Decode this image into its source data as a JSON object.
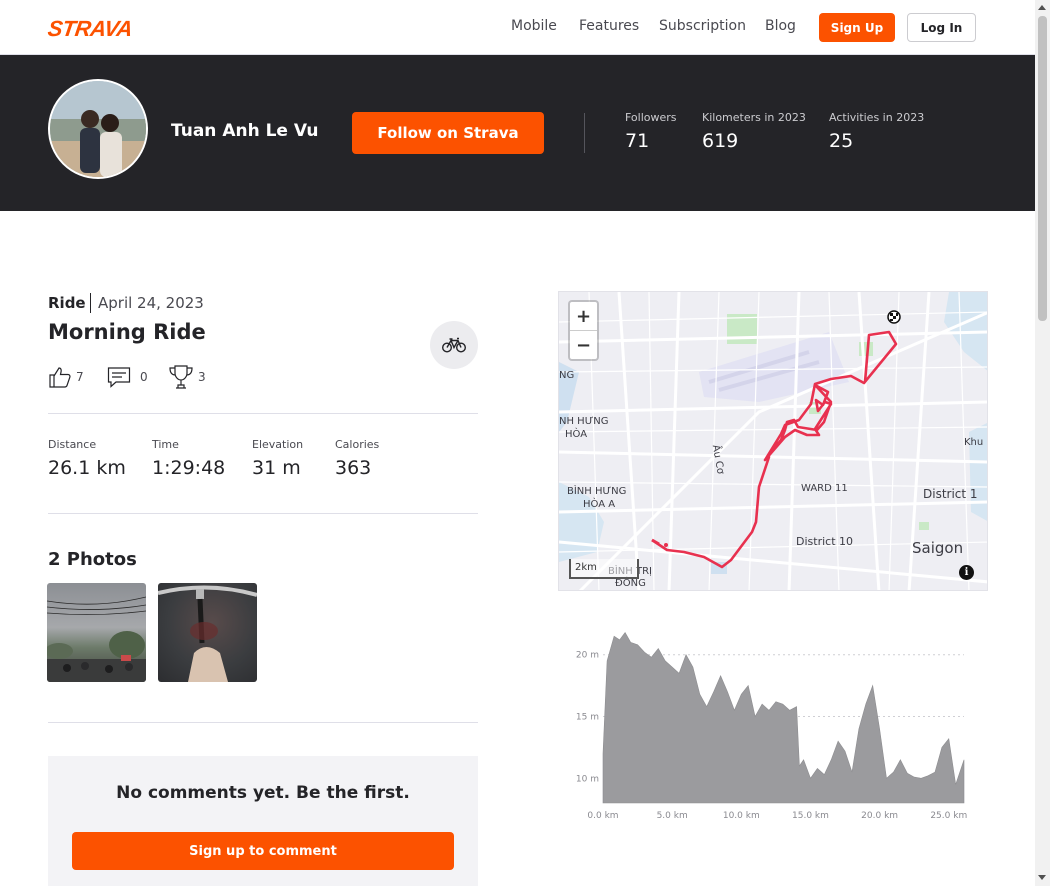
{
  "nav": {
    "logo": "STRAVA",
    "links": [
      "Mobile",
      "Features",
      "Subscription",
      "Blog"
    ],
    "sign_up": "Sign Up",
    "log_in": "Log In"
  },
  "athlete": {
    "name": "Tuan Anh Le Vu",
    "follow_label": "Follow on Strava",
    "stats": [
      {
        "label": "Followers",
        "value": "71"
      },
      {
        "label": "Kilometers in 2023",
        "value": "619"
      },
      {
        "label": "Activities in 2023",
        "value": "25"
      }
    ]
  },
  "activity": {
    "type": "Ride",
    "date": "April 24, 2023",
    "title": "Morning Ride",
    "kudos": "7",
    "comments": "0",
    "achievements": "3",
    "metrics": [
      {
        "label": "Distance",
        "value": "26.1 km"
      },
      {
        "label": "Time",
        "value": "1:29:48"
      },
      {
        "label": "Elevation",
        "value": "31 m"
      },
      {
        "label": "Calories",
        "value": "363"
      }
    ]
  },
  "photos": {
    "title": "2 Photos"
  },
  "comments": {
    "empty_text": "No comments yet. Be the first.",
    "sign_up_label": "Sign up to comment"
  },
  "map": {
    "zoom_in": "+",
    "zoom_out": "−",
    "scale": "2km",
    "info": "i",
    "labels": {
      "nh_hung": "NH HƯNG",
      "hoa": "HÒA",
      "au_co": "Âu Cơ",
      "binh_hung": "BÌNH HƯNG",
      "hoa_a": "HÒA A",
      "binh_tri": "BÌNH TRỊ",
      "dong": "ĐÔNG",
      "ward11": "WARD 11",
      "district10": "District 10",
      "district1": "District 1",
      "saigon": "Saigon",
      "khu": "Khu P",
      "ng": "NG"
    }
  },
  "chart_data": {
    "type": "area",
    "title": "",
    "xlabel": "",
    "ylabel": "",
    "x_ticks": [
      "0.0 km",
      "5.0 km",
      "10.0 km",
      "15.0 km",
      "20.0 km",
      "25.0 km"
    ],
    "y_ticks": [
      "10 m",
      "15 m",
      "20 m"
    ],
    "xlim": [
      0,
      26.1
    ],
    "ylim": [
      8,
      22
    ],
    "x": [
      0,
      0.3,
      0.8,
      1.2,
      1.6,
      2.0,
      2.5,
      3.0,
      3.5,
      4.0,
      4.5,
      5.0,
      5.5,
      6.0,
      6.5,
      7.0,
      7.5,
      8.0,
      8.5,
      9.0,
      9.5,
      10.0,
      10.5,
      11.0,
      11.5,
      12.0,
      12.5,
      13.0,
      13.5,
      14.0,
      14.2,
      14.5,
      15.0,
      15.5,
      16.0,
      16.5,
      17.0,
      17.5,
      18.0,
      18.5,
      19.0,
      19.5,
      20.0,
      20.5,
      21.0,
      21.5,
      22.0,
      22.5,
      23.0,
      23.5,
      24.0,
      24.5,
      25.0,
      25.5,
      26.1
    ],
    "y": [
      12,
      19.5,
      21.5,
      21.2,
      21.8,
      21.0,
      20.8,
      20.2,
      19.8,
      20.5,
      19.5,
      19.0,
      18.5,
      20.0,
      19.0,
      16.8,
      15.8,
      17.0,
      18.3,
      17.0,
      15.5,
      16.8,
      17.5,
      15.0,
      16.0,
      15.5,
      16.2,
      16.0,
      15.5,
      15.8,
      11.0,
      11.5,
      10.0,
      10.8,
      10.3,
      11.5,
      13.0,
      12.2,
      10.5,
      14.0,
      16.0,
      17.5,
      14.0,
      10.0,
      10.5,
      11.5,
      10.4,
      10.1,
      10.0,
      10.2,
      10.5,
      12.5,
      13.2,
      9.5,
      11.5
    ]
  }
}
